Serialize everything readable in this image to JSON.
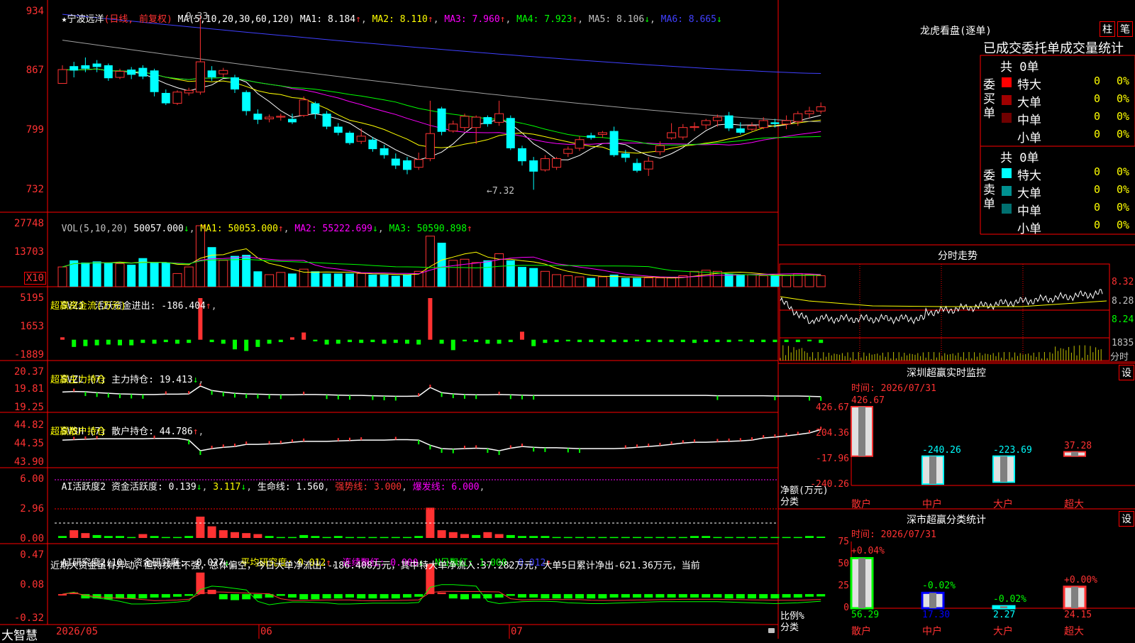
{
  "header": {
    "star": "★",
    "stock_name": "宁波远洋",
    "period": "(日线, 前复权)",
    "ma_params": "MA(5,10,20,30,60,120)",
    "ma": [
      {
        "label": "MA1: 8.184",
        "arrow": "↑",
        "color": "#ffffff"
      },
      {
        "label": "MA2: 8.110",
        "arrow": "↑",
        "color": "#ffff00"
      },
      {
        "label": "MA3: 7.960",
        "arrow": "↑",
        "color": "#ff00ff"
      },
      {
        "label": "MA4: 7.923",
        "arrow": "↑",
        "color": "#00ff00"
      },
      {
        "label": "MA5: 8.106",
        "arrow": "↓",
        "color": "#c0c0c0"
      },
      {
        "label": "MA6: 8.665",
        "arrow": "↓",
        "color": "#4040ff"
      }
    ]
  },
  "colors": {
    "up": "#ff3232",
    "down": "#00ffff",
    "grid": "#ff0000",
    "axis_text": "#ff3232",
    "yellow": "#ffff00",
    "magenta": "#ff00ff",
    "green": "#00ff00",
    "white": "#ffffff",
    "gray": "#a0a0a0",
    "blue": "#4040ff"
  },
  "price": {
    "max": 9.4,
    "min": 7.2,
    "labels": [
      "934",
      "867",
      "799",
      "732"
    ],
    "high_mark": "9.33",
    "low_mark": "←7.32"
  },
  "vol": {
    "params": "VOL(5,10,20)",
    "value": "50057.000",
    "arrow": "↓",
    "ma1": "MA1: 50053.000",
    "ma1_arrow": "↑",
    "ma2": "MA2: 55222.699",
    "ma2_arrow": "↓",
    "ma3": "MA3: 50590.898",
    "ma3_arrow": "↑",
    "labels": [
      "27748",
      "13703"
    ],
    "unit": "X10"
  },
  "svzj": {
    "title": "SVZJ  活跃资金进出: -186.404",
    "arrow": "↑",
    "sub": "超赢资金流(万元)",
    "labels": [
      "5195",
      "1653",
      "-1889"
    ]
  },
  "svzl": {
    "title": "SVZL (7) 主力持仓: 19.413",
    "arrow": "↓",
    "sub": "超赢主力持仓",
    "labels": [
      "20.37",
      "19.81",
      "19.25"
    ]
  },
  "svsh": {
    "title": "SVSH (7) 散户持仓: 44.786",
    "arrow": "↑",
    "sub": "超赢散户持仓",
    "labels": [
      "44.82",
      "44.35",
      "43.90"
    ]
  },
  "ai1": {
    "title": "AI活跃度2 资金活跃度: 0.139",
    "a1": "↓",
    "v2": "3.117",
    "a2": "↓",
    "life": "生命线: 1.560",
    "strong": "强势线: 3.000",
    "burst": "爆发线: 6.000",
    "labels": [
      "6.00",
      "2.96",
      "0.00"
    ]
  },
  "ai2": {
    "title": "AI研究度2(10) 资金研究度: -0.027",
    "a1": "↓",
    "avg": "平均研究度: 0.012",
    "a2": "↑",
    "red": "连续飘红: 0.000",
    "a3": "↓",
    "nred": "N日飘红: 1.000",
    "v5": "0.012",
    "a5": "↑",
    "desc": "近期大资金虽有异动，但持续性不强，总体偏空，今日大单净流出:-186.408万元，其中特大单净流入:37.282万元，大单5日累计净出-621.36万元，当前",
    "labels": [
      "0.47",
      "0.08",
      "-0.32"
    ]
  },
  "footer": {
    "logo": "大智慧",
    "dates": [
      "2026/05",
      "06",
      "07"
    ]
  },
  "right": {
    "lhb_title": "龙虎看盘(逐单)",
    "btn_zhu": "柱",
    "btn_bi": "笔",
    "tabs_title": "已成交委托单成交量统计",
    "buy": {
      "group": "委买单",
      "total": "共 0单",
      "rows": [
        {
          "name": "特大",
          "n": "0",
          "p": "0%"
        },
        {
          "name": "大单",
          "n": "0",
          "p": "0%"
        },
        {
          "name": "中单",
          "n": "0",
          "p": "0%"
        },
        {
          "name": "小单",
          "n": "0",
          "p": "0%"
        }
      ]
    },
    "sell": {
      "group": "委卖单",
      "total": "共 0单",
      "rows": [
        {
          "name": "特大",
          "n": "0",
          "p": "0%"
        },
        {
          "name": "大单",
          "n": "0",
          "p": "0%"
        },
        {
          "name": "中单",
          "n": "0",
          "p": "0%"
        },
        {
          "name": "小单",
          "n": "0",
          "p": "0%"
        }
      ]
    },
    "intraday": {
      "title": "分时走势",
      "labels": [
        "8.32",
        "8.28",
        "8.24"
      ],
      "vol_label": "1835",
      "vol_unit": "分时"
    },
    "monitor": {
      "title": "深圳超赢实时监控",
      "set": "设",
      "time": "时间: 2026/07/31",
      "y_labels": [
        "426.67",
        "204.36",
        "-17.96",
        "-240.26"
      ],
      "y_title": "净额(万元)",
      "x_title": "分类",
      "bars": [
        {
          "cat": "散户",
          "v": 426.67,
          "label": "426.67"
        },
        {
          "cat": "中户",
          "v": -240.26,
          "label": "-240.26"
        },
        {
          "cat": "大户",
          "v": -223.69,
          "label": "-223.69"
        },
        {
          "cat": "超大",
          "v": 37.28,
          "label": "37.28"
        }
      ]
    },
    "stats": {
      "title": "深市超赢分类统计",
      "set": "设",
      "time": "时间: 2026/07/31",
      "y_labels": [
        "75",
        "50",
        "25",
        "0"
      ],
      "y_title": "比例%",
      "x_title": "分类",
      "bars": [
        {
          "cat": "散户",
          "v": 56.29,
          "label": "56.29",
          "chg": "+0.04%"
        },
        {
          "cat": "中户",
          "v": 17.3,
          "label": "17.30",
          "chg": "-0.02%"
        },
        {
          "cat": "大户",
          "v": 2.27,
          "label": "2.27",
          "chg": "-0.02%"
        },
        {
          "cat": "超大",
          "v": 24.15,
          "label": "24.15",
          "chg": "+0.00%"
        }
      ]
    }
  },
  "chart_data": {
    "type": "candlestick",
    "candles": [
      [
        8.55,
        8.71,
        8.76,
        8.55
      ],
      [
        8.75,
        8.7,
        8.8,
        8.62
      ],
      [
        8.76,
        8.72,
        8.85,
        8.68
      ],
      [
        8.78,
        8.74,
        8.82,
        8.68
      ],
      [
        8.76,
        8.61,
        8.78,
        8.58
      ],
      [
        8.62,
        8.69,
        8.72,
        8.6
      ],
      [
        8.71,
        8.65,
        8.74,
        8.6
      ],
      [
        8.73,
        8.63,
        8.76,
        8.6
      ],
      [
        8.7,
        8.45,
        8.72,
        8.4
      ],
      [
        8.44,
        8.32,
        8.48,
        8.3
      ],
      [
        8.32,
        8.45,
        8.47,
        8.3
      ],
      [
        8.44,
        8.47,
        8.5,
        8.41
      ],
      [
        8.45,
        8.8,
        9.33,
        8.42
      ],
      [
        8.7,
        8.62,
        8.75,
        8.58
      ],
      [
        8.66,
        8.7,
        8.73,
        8.62
      ],
      [
        8.62,
        8.48,
        8.65,
        8.44
      ],
      [
        8.45,
        8.23,
        8.47,
        8.18
      ],
      [
        8.2,
        8.13,
        8.25,
        8.08
      ],
      [
        8.14,
        8.16,
        8.19,
        8.1
      ],
      [
        8.16,
        8.17,
        8.2,
        8.12
      ],
      [
        8.14,
        8.1,
        8.2,
        8.08
      ],
      [
        8.18,
        8.36,
        8.4,
        8.16
      ],
      [
        8.32,
        8.2,
        8.34,
        8.14
      ],
      [
        8.2,
        8.05,
        8.23,
        8.02
      ],
      [
        8.05,
        7.98,
        8.09,
        7.95
      ],
      [
        7.98,
        7.86,
        8.0,
        7.84
      ],
      [
        7.88,
        7.94,
        8.03,
        7.85
      ],
      [
        7.9,
        7.79,
        7.93,
        7.76
      ],
      [
        7.8,
        7.72,
        7.84,
        7.68
      ],
      [
        7.68,
        7.6,
        7.74,
        7.56
      ],
      [
        7.66,
        7.55,
        7.7,
        7.5
      ],
      [
        7.58,
        7.67,
        7.75,
        7.55
      ],
      [
        7.68,
        7.97,
        8.35,
        7.65
      ],
      [
        8.26,
        7.99,
        8.28,
        7.95
      ],
      [
        8.0,
        8.08,
        8.12,
        7.98
      ],
      [
        8.04,
        8.17,
        8.2,
        8.0
      ],
      [
        8.04,
        8.16,
        8.18,
        7.85
      ],
      [
        8.16,
        8.08,
        8.18,
        8.05
      ],
      [
        8.1,
        8.2,
        8.35,
        8.06
      ],
      [
        8.15,
        7.8,
        8.18,
        7.78
      ],
      [
        7.8,
        7.65,
        7.83,
        7.6
      ],
      [
        7.66,
        7.53,
        7.7,
        7.32
      ],
      [
        7.55,
        7.68,
        7.72,
        7.53
      ],
      [
        7.58,
        7.68,
        7.7,
        7.55
      ],
      [
        7.74,
        7.79,
        7.82,
        7.7
      ],
      [
        7.8,
        7.9,
        7.94,
        7.77
      ],
      [
        7.95,
        7.92,
        7.98,
        7.9
      ],
      [
        7.96,
        7.98,
        8.0,
        7.92
      ],
      [
        8.0,
        7.72,
        8.05,
        7.7
      ],
      [
        7.74,
        7.69,
        7.78,
        7.64
      ],
      [
        7.63,
        7.54,
        7.68,
        7.52
      ],
      [
        7.56,
        7.65,
        7.7,
        7.48
      ],
      [
        7.76,
        7.83,
        7.88,
        7.72
      ],
      [
        7.92,
        7.98,
        8.09,
        7.9
      ],
      [
        7.93,
        8.04,
        8.08,
        7.9
      ],
      [
        8.04,
        8.05,
        8.1,
        8.0
      ],
      [
        8.07,
        8.12,
        8.14,
        8.02
      ],
      [
        8.12,
        8.16,
        8.19,
        8.05
      ],
      [
        8.18,
        8.03,
        8.22,
        8.0
      ],
      [
        8.03,
        7.98,
        8.1,
        7.96
      ],
      [
        8.02,
        8.06,
        8.1,
        8.0
      ],
      [
        8.04,
        8.12,
        8.16,
        8.02
      ],
      [
        8.1,
        8.08,
        8.14,
        8.04
      ],
      [
        8.08,
        8.12,
        8.18,
        8.02
      ],
      [
        8.11,
        8.2,
        8.23,
        8.06
      ],
      [
        8.2,
        8.23,
        8.28,
        8.15
      ],
      [
        8.23,
        8.28,
        8.33,
        8.2
      ]
    ],
    "volume": [
      9000,
      12000,
      11000,
      11500,
      11000,
      10500,
      10000,
      13000,
      11000,
      11000,
      6000,
      9000,
      27748,
      18000,
      12000,
      14000,
      14500,
      7000,
      5500,
      6500,
      6000,
      8000,
      7000,
      6000,
      6000,
      6000,
      6000,
      5500,
      5500,
      5000,
      5500,
      7000,
      23000,
      20000,
      12000,
      12500,
      11000,
      12000,
      15000,
      12000,
      9000,
      8500,
      7000,
      5500,
      5000,
      4500,
      4000,
      4500,
      5500,
      4000,
      4000,
      4000,
      4000,
      4000,
      5000,
      7000,
      7500,
      7000,
      6000,
      5500,
      5500,
      5000,
      5000,
      5000,
      6000,
      5500,
      5000
    ],
    "fund_flow": [
      300,
      -900,
      -800,
      -700,
      -600,
      -700,
      -700,
      -400,
      -500,
      -300,
      -500,
      -400,
      5195,
      -300,
      -500,
      -1200,
      -1400,
      -900,
      -500,
      -300,
      300,
      900,
      -200,
      -600,
      -500,
      -300,
      -400,
      -300,
      -500,
      -400,
      -500,
      -600,
      5195,
      -500,
      -1300,
      -200,
      -300,
      -500,
      -500,
      -300,
      1000,
      -800,
      -400,
      -300,
      -200,
      -300,
      -300,
      -300,
      -300,
      -300,
      -200,
      -300,
      -300,
      -300,
      -300,
      -400,
      -300,
      -300,
      -300,
      -200,
      -300,
      -300,
      -300,
      -300,
      -300,
      -200,
      -400
    ],
    "main_hold": [
      19.8,
      19.82,
      19.81,
      19.78,
      19.76,
      19.74,
      19.73,
      19.72,
      19.72,
      19.73,
      19.73,
      19.74,
      20.0,
      19.85,
      19.8,
      19.76,
      19.74,
      19.73,
      19.72,
      19.71,
      19.71,
      19.72,
      19.72,
      19.71,
      19.7,
      19.69,
      19.69,
      19.68,
      19.67,
      19.66,
      19.66,
      19.67,
      19.95,
      19.78,
      19.74,
      19.72,
      19.71,
      19.71,
      19.72,
      19.71,
      19.7,
      19.69,
      19.69,
      19.69,
      19.69,
      19.69,
      19.69,
      19.69,
      19.69,
      19.69,
      19.69,
      19.69,
      19.69,
      19.69,
      19.69,
      19.69,
      19.69,
      19.68,
      19.68,
      19.68,
      19.68,
      19.68,
      19.67,
      19.67,
      19.67,
      19.66,
      19.65
    ],
    "retail_hold": [
      44.45,
      44.46,
      44.47,
      44.48,
      44.48,
      44.48,
      44.48,
      44.48,
      44.49,
      44.49,
      44.49,
      44.45,
      44.2,
      44.25,
      44.28,
      44.3,
      44.35,
      44.35,
      44.36,
      44.37,
      44.4,
      44.42,
      44.42,
      44.42,
      44.43,
      44.44,
      44.45,
      44.45,
      44.45,
      44.46,
      44.46,
      44.45,
      44.33,
      44.25,
      44.24,
      44.25,
      44.26,
      44.25,
      44.2,
      44.26,
      44.3,
      44.28,
      44.27,
      44.27,
      44.26,
      44.25,
      44.25,
      44.25,
      44.25,
      44.26,
      44.28,
      44.3,
      44.32,
      44.35,
      44.38,
      44.4,
      44.4,
      44.41,
      44.42,
      44.43,
      44.45,
      44.5,
      44.52,
      44.55,
      44.58,
      44.62,
      44.7
    ],
    "activity": [
      0.2,
      0.8,
      0.5,
      0.3,
      0.2,
      0.2,
      0.1,
      0.4,
      0.2,
      0.1,
      0.1,
      0.2,
      2.2,
      1.2,
      0.8,
      0.6,
      0.5,
      0.4,
      0.2,
      0.1,
      0.1,
      0.3,
      0.2,
      0.1,
      0.2,
      0.1,
      0.1,
      0.1,
      0.1,
      0.1,
      0.1,
      0.2,
      3.117,
      0.8,
      0.6,
      0.4,
      0.3,
      0.6,
      0.4,
      0.3,
      0.2,
      0.2,
      0.2,
      0.1,
      0.1,
      0.1,
      0.1,
      0.1,
      0.1,
      0.1,
      0.1,
      0.1,
      0.1,
      0.1,
      0.1,
      0.2,
      0.2,
      0.1,
      0.1,
      0.1,
      0.1,
      0.1,
      0.1,
      0.1,
      0.1,
      0.2,
      0.139
    ],
    "research": [
      0.0,
      0.02,
      -0.05,
      -0.05,
      -0.06,
      -0.05,
      -0.05,
      -0.05,
      -0.04,
      -0.04,
      -0.03,
      -0.02,
      0.25,
      0.05,
      -0.06,
      -0.07,
      -0.06,
      -0.05,
      -0.04,
      -0.02,
      -0.04,
      -0.06,
      -0.06,
      -0.05,
      -0.05,
      -0.04,
      -0.05,
      -0.05,
      -0.05,
      -0.05,
      -0.04,
      -0.03,
      0.35,
      0.02,
      -0.05,
      -0.06,
      -0.05,
      -0.05,
      -0.04,
      -0.02,
      -0.04,
      -0.04,
      -0.05,
      -0.05,
      -0.05,
      -0.05,
      -0.05,
      -0.05,
      -0.04,
      -0.04,
      -0.04,
      -0.04,
      -0.04,
      -0.04,
      -0.04,
      -0.04,
      -0.04,
      -0.04,
      -0.05,
      -0.05,
      -0.05,
      -0.05,
      -0.05,
      -0.04,
      -0.04,
      -0.03,
      -0.027
    ]
  }
}
